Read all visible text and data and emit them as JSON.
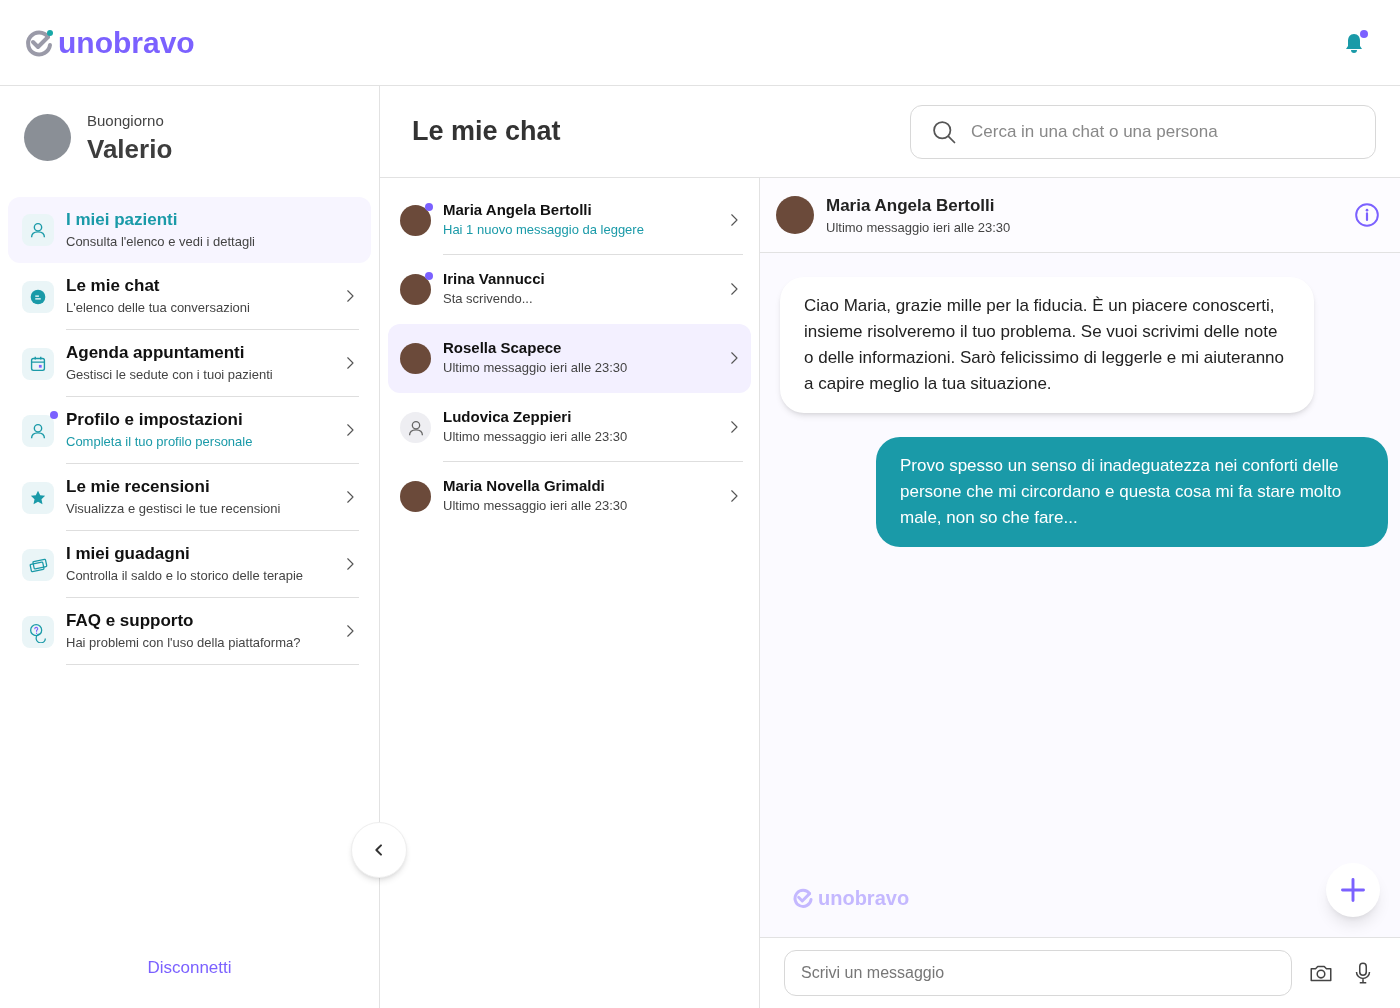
{
  "header": {
    "logo": "unobravo",
    "notifications_unread": true
  },
  "sidebar": {
    "greeting": "Buongiorno",
    "user_name": "Valerio",
    "items": [
      {
        "title": "I miei pazienti",
        "subtitle": "Consulta l'elenco e vedi i dettagli",
        "selected": true,
        "badge": false,
        "highlight": false
      },
      {
        "title": "Le mie chat",
        "subtitle": "L'elenco delle tua conversazioni",
        "selected": false,
        "badge": false,
        "highlight": false
      },
      {
        "title": "Agenda appuntamenti",
        "subtitle": "Gestisci le sedute con i tuoi pazienti",
        "selected": false,
        "badge": false,
        "highlight": false
      },
      {
        "title": "Profilo e impostazioni",
        "subtitle": "Completa il tuo profilo personale",
        "selected": false,
        "badge": true,
        "highlight": true
      },
      {
        "title": "Le mie recensioni",
        "subtitle": "Visualizza e gestisci le tue recensioni",
        "selected": false,
        "badge": false,
        "highlight": false
      },
      {
        "title": "I miei guadagni",
        "subtitle": "Controlla il saldo e lo storico delle terapie",
        "selected": false,
        "badge": false,
        "highlight": false
      },
      {
        "title": "FAQ e supporto",
        "subtitle": "Hai problemi con l'uso della piattaforma?",
        "selected": false,
        "badge": false,
        "highlight": false
      }
    ],
    "logout": "Disconnetti"
  },
  "chats": {
    "title": "Le mie chat",
    "search": {
      "placeholder": "Cerca in una chat o una persona"
    },
    "items": [
      {
        "name": "Maria Angela Bertolli",
        "preview": "Hai 1 nuovo messaggio da leggere",
        "unread": true,
        "selected": false,
        "kind": "photo"
      },
      {
        "name": "Irina Vannucci",
        "preview": "Sta scrivendo...",
        "unread": true,
        "selected": false,
        "kind": "photo"
      },
      {
        "name": "Rosella Scapece",
        "preview": "Ultimo messaggio ieri alle 23:30",
        "unread": false,
        "selected": true,
        "kind": "photo"
      },
      {
        "name": "Ludovica Zeppieri",
        "preview": "Ultimo messaggio ieri alle 23:30",
        "unread": false,
        "selected": false,
        "kind": "placeholder"
      },
      {
        "name": "Maria Novella Grimaldi",
        "preview": "Ultimo messaggio ieri alle 23:30",
        "unread": false,
        "selected": false,
        "kind": "photo"
      }
    ]
  },
  "conversation": {
    "contact": "Maria Angela Bertolli",
    "status": "Ultimo messaggio ieri alle 23:30",
    "messages": [
      {
        "kind": "received",
        "text": "Ciao Maria, grazie mille per la fiducia. È un piacere conoscerti, insieme risolveremo il tuo problema. Se vuoi scrivimi delle note o delle informazioni. Sarò felicissimo di leggerle e mi aiuteranno a capire meglio la tua situazione."
      },
      {
        "kind": "sent",
        "text": "Provo spesso un senso di inadeguatezza nei conforti delle persone che mi circordano e questa cosa mi fa stare molto male, non so che fare..."
      }
    ],
    "brand": "unobravo",
    "input": {
      "placeholder": "Scrivi un messaggio"
    }
  }
}
